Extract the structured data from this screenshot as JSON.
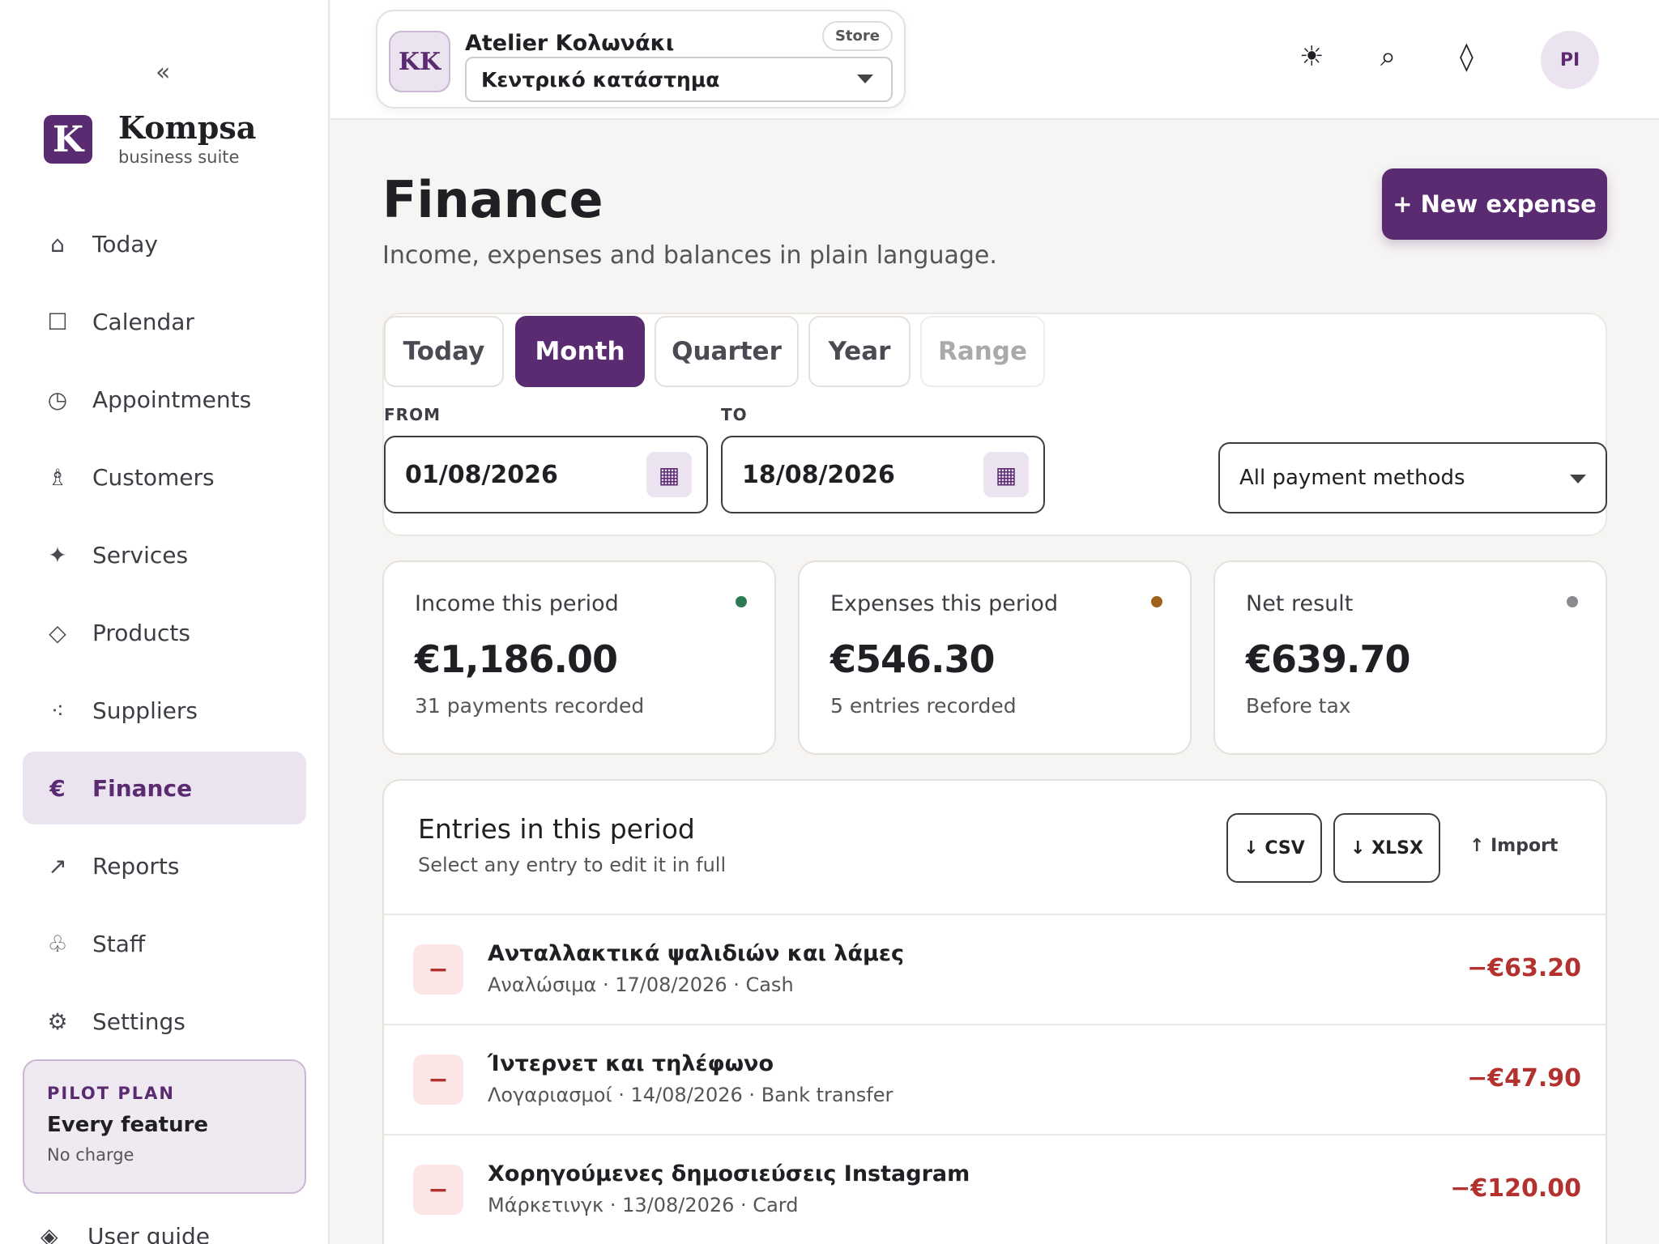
{
  "sidebar": {
    "collapse": "«",
    "brand": {
      "mark": "K",
      "name": "Kompsa",
      "sub": "business suite"
    },
    "items": [
      {
        "icon": "⌂",
        "label": "Today"
      },
      {
        "icon": "☐",
        "label": "Calendar"
      },
      {
        "icon": "◷",
        "label": "Appointments"
      },
      {
        "icon": "♗",
        "label": "Customers"
      },
      {
        "icon": "✦",
        "label": "Services"
      },
      {
        "icon": "◇",
        "label": "Products"
      },
      {
        "icon": "⁖",
        "label": "Suppliers"
      },
      {
        "icon": "€",
        "label": "Finance"
      },
      {
        "icon": "↗",
        "label": "Reports"
      },
      {
        "icon": "♧",
        "label": "Staff"
      },
      {
        "icon": "⚙",
        "label": "Settings"
      }
    ],
    "plan": {
      "tag": "PILOT PLAN",
      "title": "Every feature",
      "sub": "No charge"
    },
    "guide": {
      "icon": "◈",
      "label": "User guide"
    }
  },
  "header": {
    "store": {
      "initials": "KK",
      "name": "Atelier Κολωνάκι",
      "badge": "Store",
      "location": "Κεντρικό κατάστημα"
    },
    "icons": {
      "theme": "☀",
      "search": "⌕",
      "diamond": "◊"
    },
    "user_initials": "PI"
  },
  "page": {
    "title": "Finance",
    "subtitle": "Income, expenses and balances in plain language.",
    "new_button": "+ New expense"
  },
  "filters": {
    "segments": [
      "Today",
      "Month",
      "Quarter",
      "Year",
      "Range"
    ],
    "from_label": "FROM",
    "to_label": "TO",
    "from_value": "01/08/2026",
    "to_value": "18/08/2026",
    "calendar_icon": "▦",
    "payment_method": "All payment methods"
  },
  "stats": [
    {
      "label": "Income this period",
      "value": "€1,186.00",
      "sub": "31 payments recorded",
      "dot": "#2e7a55"
    },
    {
      "label": "Expenses this period",
      "value": "€546.30",
      "sub": "5 entries recorded",
      "dot": "#a0621a"
    },
    {
      "label": "Net result",
      "value": "€639.70",
      "sub": "Before tax",
      "dot": "#8a8a8f"
    }
  ],
  "entries": {
    "title": "Entries in this period",
    "subtitle": "Select any entry to edit it in full",
    "csv": "↓ CSV",
    "xlsx": "↓ XLSX",
    "import": "↑ Import",
    "rows": [
      {
        "mark": "−",
        "title": "Ανταλλακτικά ψαλιδιών και λάμες",
        "meta": "Αναλώσιμα · 17/08/2026 · Cash",
        "amount": "−€63.20"
      },
      {
        "mark": "−",
        "title": "Ίντερνετ και τηλέφωνο",
        "meta": "Λογαριασμοί · 14/08/2026 · Bank transfer",
        "amount": "−€47.90"
      },
      {
        "mark": "−",
        "title": "Χορηγούμενες δημοσιεύσεις Instagram",
        "meta": "Μάρκετινγκ · 13/08/2026 · Card",
        "amount": "−€120.00"
      }
    ]
  },
  "colors": {
    "accent": "#5b2b72",
    "accent_soft": "#ece3f1",
    "negative": "#b3312f"
  }
}
